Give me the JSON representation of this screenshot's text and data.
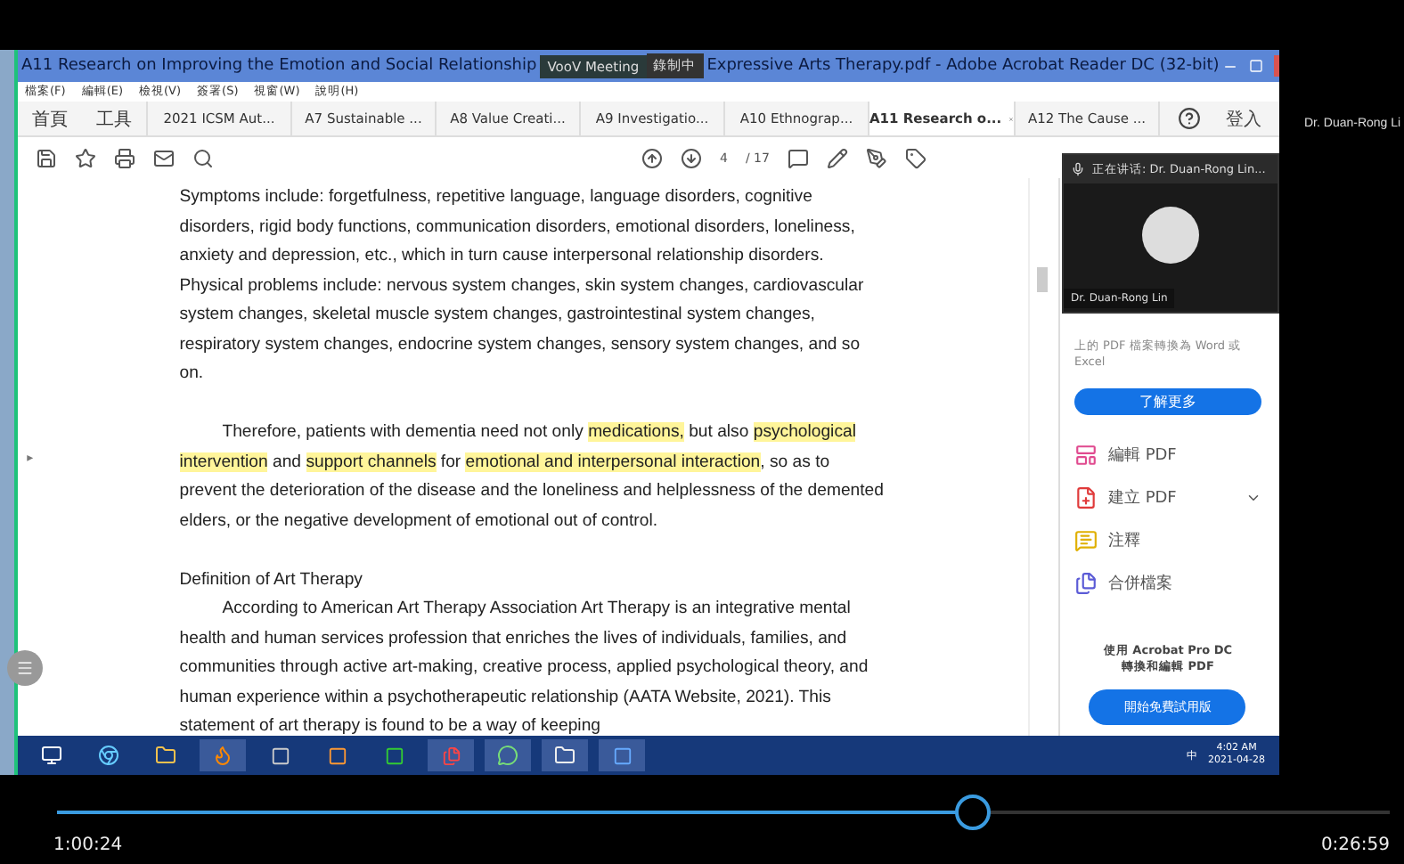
{
  "window": {
    "title_left": "A11 Research on Improving the Emotion and Social Relationship",
    "title_right": "Expressive Arts Therapy.pdf - Adobe Acrobat Reader DC (32-bit)"
  },
  "meeting": {
    "app": "VooV Meeting",
    "recording": "錄制中",
    "speaker": "正在讲话: Dr. Duan-Rong Lin...",
    "participant": "Dr. Duan-Rong Lin",
    "viewer_name": "Dr. Duan-Rong Li"
  },
  "menu": [
    "檔案(F)",
    "編輯(E)",
    "檢視(V)",
    "簽署(S)",
    "視窗(W)",
    "說明(H)"
  ],
  "nav_tabs": [
    "首頁",
    "工具"
  ],
  "tabs": [
    {
      "label": "2021 ICSM Aut...",
      "selected": false
    },
    {
      "label": "A7 Sustainable ...",
      "selected": false
    },
    {
      "label": "A8 Value Creati...",
      "selected": false
    },
    {
      "label": "A9 Investigatio...",
      "selected": false
    },
    {
      "label": "A10 Ethnograp...",
      "selected": false
    },
    {
      "label": "A11 Research o...",
      "selected": true
    },
    {
      "label": "A12 The Cause ...",
      "selected": false
    }
  ],
  "sign_in": "登入",
  "gutter_arrow": "▸",
  "page": {
    "current": "4",
    "total": "/ 17"
  },
  "document": [
    {
      "kind": "paragraph",
      "indent": false,
      "segments": [
        {
          "text": "Symptoms include: forgetfulness, repetitive language, language disorders, cognitive disorders, rigid body functions, communication disorders, emotional disorders, loneliness, anxiety and depression, etc., which in turn cause interpersonal relationship disorders. Physical problems include: nervous system changes, skin system changes, cardiovascular system changes, skeletal muscle system changes, gastrointestinal system changes, respiratory system changes, endocrine system changes, sensory system changes, and so on.",
          "highlight": false
        }
      ]
    },
    {
      "kind": "paragraph",
      "indent": true,
      "segments": [
        {
          "text": "Therefore, patients with dementia need not only ",
          "highlight": false
        },
        {
          "text": "medications,",
          "highlight": true
        },
        {
          "text": " but also ",
          "highlight": false
        },
        {
          "text": "psychological intervention",
          "highlight": true
        },
        {
          "text": " and ",
          "highlight": false
        },
        {
          "text": "support channels",
          "highlight": true
        },
        {
          "text": " for ",
          "highlight": false
        },
        {
          "text": "emotional and interpersonal interaction",
          "highlight": true
        },
        {
          "text": ", so as to prevent the deterioration of the disease and the loneliness and helplessness of the demented elders, or the negative development of emotional out of control.",
          "highlight": false
        }
      ]
    },
    {
      "kind": "heading",
      "indent": false,
      "segments": [
        {
          "text": "Definition of Art Therapy",
          "highlight": false
        }
      ]
    },
    {
      "kind": "paragraph",
      "indent": true,
      "segments": [
        {
          "text": "According to American Art Therapy Association Art Therapy is an integrative mental health and human services profession that enriches the lives of individuals, families, and communities through active art-making, creative process, applied psychological theory, and human experience within a psychotherapeutic relationship (AATA Website, 2021). This statement of art therapy is found to be a way of keeping",
          "highlight": false
        }
      ]
    }
  ],
  "side_pane": {
    "intro": "上的 PDF 檔案轉換為 Word 或 Excel",
    "learn_more": "了解更多",
    "tools": [
      {
        "kind": "edit",
        "label": "編輯 PDF",
        "expandable": false
      },
      {
        "kind": "create",
        "label": "建立 PDF",
        "expandable": true
      },
      {
        "kind": "comment",
        "label": "注釋",
        "expandable": false
      },
      {
        "kind": "combine",
        "label": "合併檔案",
        "expandable": false
      }
    ],
    "promo": [
      "使用 Acrobat Pro DC",
      "轉換和編輯 PDF"
    ],
    "trial": "開始免費試用版"
  },
  "taskbar": {
    "ime": "中",
    "time": "4:02 AM",
    "date": "2021-04-28"
  },
  "player": {
    "level": 0.687,
    "elapsed": "1:00:24",
    "remaining": "0:26:59"
  }
}
